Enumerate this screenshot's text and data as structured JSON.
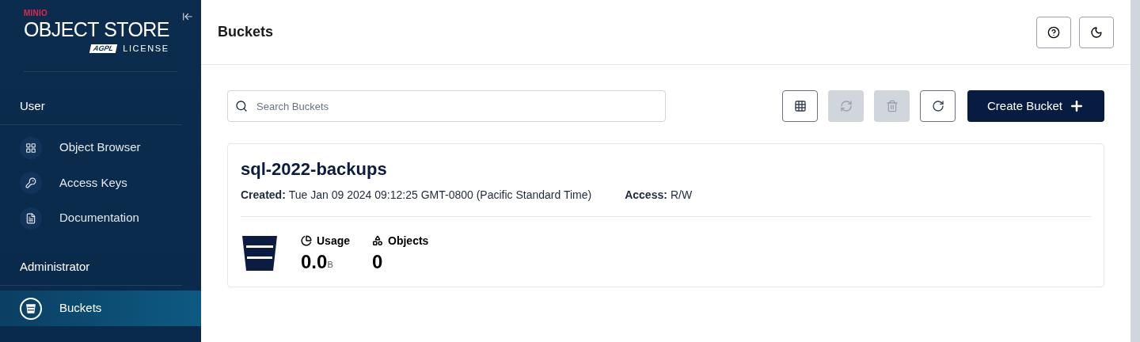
{
  "sidebar": {
    "logo": {
      "brand": "MINIO",
      "product": "**OBJECT** STORE",
      "badge": "AGPL",
      "license": "LICENSE"
    },
    "sections": [
      {
        "title": "User",
        "items": [
          {
            "label": "Object Browser",
            "kind": "browser",
            "selected": false
          },
          {
            "label": "Access Keys",
            "kind": "keys",
            "selected": false
          },
          {
            "label": "Documentation",
            "kind": "docs",
            "selected": false
          }
        ]
      },
      {
        "title": "Administrator",
        "items": [
          {
            "label": "Buckets",
            "kind": "bucket",
            "selected": true
          }
        ]
      }
    ]
  },
  "header": {
    "title": "Buckets"
  },
  "toolbar": {
    "search": {
      "placeholder": "Search Buckets"
    },
    "buttons": [
      {
        "kind": "grid",
        "disabled": false
      },
      {
        "kind": "replicate",
        "disabled": true
      },
      {
        "kind": "delete",
        "disabled": true
      },
      {
        "kind": "refresh",
        "disabled": false
      }
    ],
    "create_button": "Create Bucket"
  },
  "buckets": [
    {
      "name": "sql-2022-backups",
      "created_label": "Created:",
      "created": "Tue Jan 09 2024 09:12:25 GMT-0800 (Pacific Standard Time)",
      "access_label": "Access:",
      "access": "R/W",
      "usage_label": "Usage",
      "usage_value": "0.0",
      "usage_unit": "B",
      "objects_label": "Objects",
      "objects_value": "0"
    }
  ]
}
